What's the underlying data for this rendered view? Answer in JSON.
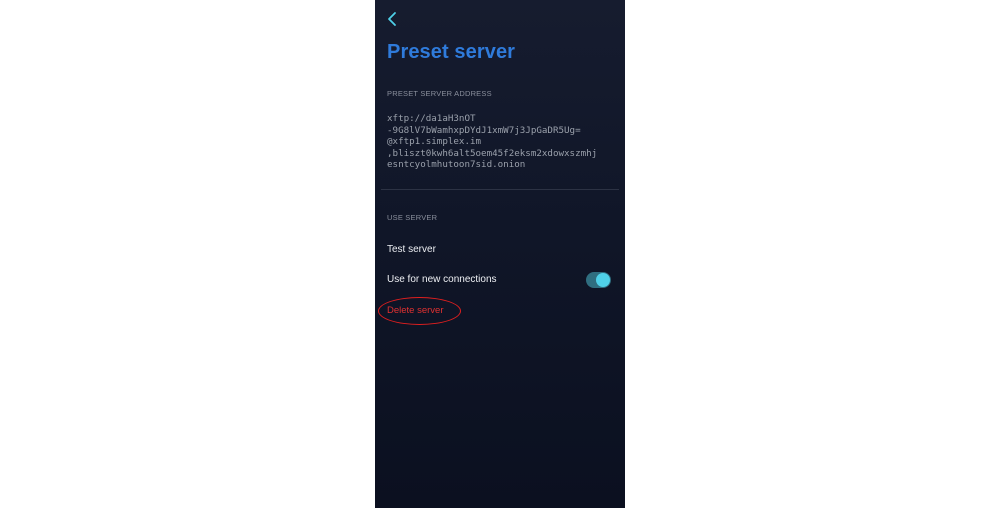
{
  "header": {
    "back_icon": "chevron-left-icon",
    "title": "Preset server"
  },
  "address_section": {
    "header": "PRESET SERVER ADDRESS",
    "lines": [
      "xftp://da1aH3nOT",
      "-9G8lV7bWamhxpDYdJ1xmW7j3JpGaDR5Ug=",
      "@xftp1.simplex.im",
      ",bliszt0kwh6alt5oem45f2eksm2xdowxszmhj",
      "esntcyolmhutoon7sid.onion"
    ]
  },
  "use_section": {
    "header": "USE SERVER",
    "test_label": "Test server",
    "use_new_label": "Use for new connections",
    "use_new_enabled": true,
    "delete_label": "Delete server"
  },
  "colors": {
    "title": "#2f7bdb",
    "accent": "#4fd0e8",
    "danger": "#e03131",
    "annotation": "#e01f1f"
  }
}
